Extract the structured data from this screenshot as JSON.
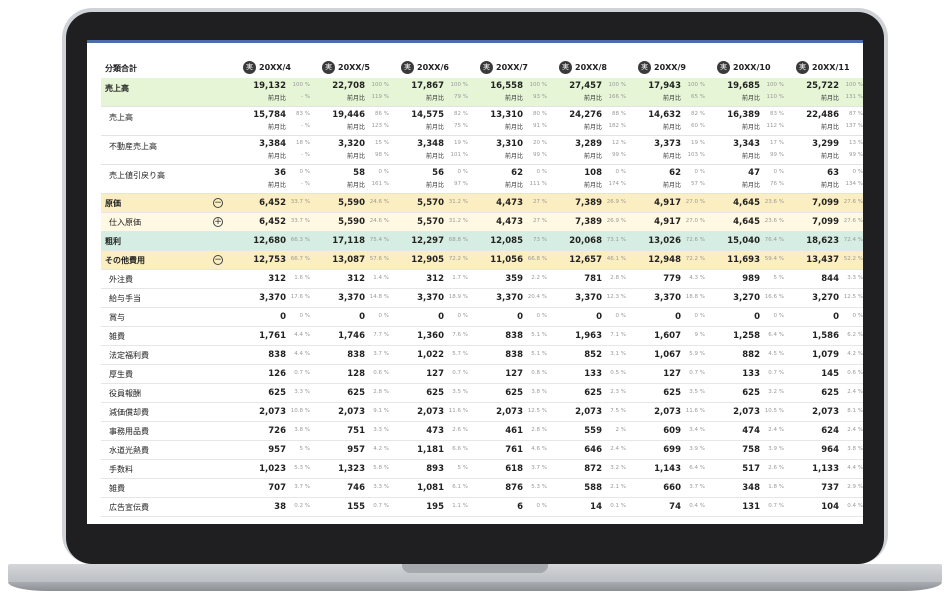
{
  "header": {
    "label": "分類合計",
    "icon_glyph": "実",
    "periods": [
      "20XX/4",
      "20XX/5",
      "20XX/6",
      "20XX/7",
      "20XX/8",
      "20XX/9",
      "20XX/10",
      "20XX/11"
    ]
  },
  "toggle_glyphs": {
    "collapse": "−",
    "expand": "+"
  },
  "sub_label": "前月比",
  "rows": [
    {
      "label": "売上高",
      "style": "sales",
      "double": true,
      "values": [
        "19,132",
        "22,708",
        "17,867",
        "16,558",
        "27,457",
        "17,943",
        "19,685",
        "25,722"
      ],
      "pcts": [
        "100 %",
        "100 %",
        "100 %",
        "100 %",
        "100 %",
        "100 %",
        "100 %",
        "100 %"
      ],
      "sub_pcts": [
        "- %",
        "119 %",
        "79 %",
        "93 %",
        "166 %",
        "65 %",
        "110 %",
        "131 %"
      ]
    },
    {
      "label": "売上高",
      "style": "",
      "indent": true,
      "double": true,
      "values": [
        "15,784",
        "19,446",
        "14,575",
        "13,310",
        "24,276",
        "14,632",
        "16,389",
        "22,486"
      ],
      "pcts": [
        "83 %",
        "86 %",
        "82 %",
        "80 %",
        "88 %",
        "82 %",
        "83 %",
        "87 %"
      ],
      "sub_pcts": [
        "- %",
        "123 %",
        "75 %",
        "91 %",
        "182 %",
        "60 %",
        "112 %",
        "137 %"
      ]
    },
    {
      "label": "不動産売上高",
      "style": "",
      "indent": true,
      "double": true,
      "values": [
        "3,384",
        "3,320",
        "3,348",
        "3,310",
        "3,289",
        "3,373",
        "3,343",
        "3,299"
      ],
      "pcts": [
        "18 %",
        "15 %",
        "19 %",
        "20 %",
        "12 %",
        "19 %",
        "17 %",
        "13 %"
      ],
      "sub_pcts": [
        "- %",
        "98 %",
        "101 %",
        "99 %",
        "99 %",
        "103 %",
        "99 %",
        "99 %"
      ]
    },
    {
      "label": "売上値引戻り高",
      "style": "",
      "indent": true,
      "double": true,
      "values": [
        "36",
        "58",
        "56",
        "62",
        "108",
        "62",
        "47",
        "63"
      ],
      "pcts": [
        "0 %",
        "0 %",
        "0 %",
        "0 %",
        "0 %",
        "0 %",
        "0 %",
        "0 %"
      ],
      "sub_pcts": [
        "- %",
        "161 %",
        "97 %",
        "111 %",
        "174 %",
        "57 %",
        "76 %",
        "134 %"
      ]
    },
    {
      "label": "原価",
      "style": "cost",
      "toggle": "collapse",
      "values": [
        "6,452",
        "5,590",
        "5,570",
        "4,473",
        "7,389",
        "4,917",
        "4,645",
        "7,099"
      ],
      "pcts": [
        "33.7 %",
        "24.6 %",
        "31.2 %",
        "27 %",
        "26.9 %",
        "27.0 %",
        "23.6 %",
        "27.6 %"
      ]
    },
    {
      "label": "仕入原価",
      "style": "cost-sub",
      "indent": true,
      "toggle": "expand",
      "values": [
        "6,452",
        "5,590",
        "5,570",
        "4,473",
        "7,389",
        "4,917",
        "4,645",
        "7,099"
      ],
      "pcts": [
        "33.7 %",
        "24.6 %",
        "31.2 %",
        "27 %",
        "26.9 %",
        "27.0 %",
        "23.6 %",
        "27.6 %"
      ]
    },
    {
      "label": "粗利",
      "style": "gross",
      "values": [
        "12,680",
        "17,118",
        "12,297",
        "12,085",
        "20,068",
        "13,026",
        "15,040",
        "18,623"
      ],
      "pcts": [
        "66.3 %",
        "75.4 %",
        "68.8 %",
        "73 %",
        "73.1 %",
        "72.6 %",
        "76.4 %",
        "72.4 %"
      ]
    },
    {
      "label": "その他費用",
      "style": "other",
      "toggle": "collapse",
      "values": [
        "12,753",
        "13,087",
        "12,905",
        "11,056",
        "12,657",
        "12,948",
        "11,693",
        "13,437"
      ],
      "pcts": [
        "66.7 %",
        "57.6 %",
        "72.2 %",
        "66.8 %",
        "46.1 %",
        "72.2 %",
        "59.4 %",
        "52.2 %"
      ]
    },
    {
      "label": "外注費",
      "indent": true,
      "values": [
        "312",
        "312",
        "312",
        "359",
        "781",
        "779",
        "989",
        "844"
      ],
      "pcts": [
        "1.6 %",
        "1.4 %",
        "1.7 %",
        "2.2 %",
        "2.8 %",
        "4.3 %",
        "5 %",
        "3.3 %"
      ]
    },
    {
      "label": "給与手当",
      "indent": true,
      "values": [
        "3,370",
        "3,370",
        "3,370",
        "3,370",
        "3,370",
        "3,370",
        "3,270",
        "3,270"
      ],
      "pcts": [
        "17.6 %",
        "14.8 %",
        "18.9 %",
        "20.4 %",
        "12.3 %",
        "18.8 %",
        "16.6 %",
        "12.5 %"
      ]
    },
    {
      "label": "賞与",
      "indent": true,
      "values": [
        "0",
        "0",
        "0",
        "0",
        "0",
        "0",
        "0",
        "0"
      ],
      "pcts": [
        "0 %",
        "0 %",
        "0 %",
        "0 %",
        "0 %",
        "0 %",
        "0 %",
        "0 %"
      ]
    },
    {
      "label": "雑費",
      "indent": true,
      "values": [
        "1,761",
        "1,746",
        "1,360",
        "838",
        "1,963",
        "1,607",
        "1,258",
        "1,586"
      ],
      "pcts": [
        "4.4 %",
        "7.7 %",
        "7.6 %",
        "5.1 %",
        "7.1 %",
        "9 %",
        "6.4 %",
        "6.2 %"
      ]
    },
    {
      "label": "法定福利費",
      "indent": true,
      "values": [
        "838",
        "838",
        "1,022",
        "838",
        "852",
        "1,067",
        "882",
        "1,079"
      ],
      "pcts": [
        "4.4 %",
        "3.7 %",
        "5.7 %",
        "5.1 %",
        "3.1 %",
        "5.9 %",
        "4.5 %",
        "4.2 %"
      ]
    },
    {
      "label": "厚生費",
      "indent": true,
      "values": [
        "126",
        "128",
        "127",
        "127",
        "133",
        "127",
        "133",
        "145"
      ],
      "pcts": [
        "0.7 %",
        "0.6 %",
        "0.7 %",
        "0.8 %",
        "0.5 %",
        "0.7 %",
        "0.7 %",
        "0.6 %"
      ]
    },
    {
      "label": "役員報酬",
      "indent": true,
      "values": [
        "625",
        "625",
        "625",
        "625",
        "625",
        "625",
        "625",
        "625"
      ],
      "pcts": [
        "3.3 %",
        "2.8 %",
        "3.5 %",
        "3.8 %",
        "2.3 %",
        "3.5 %",
        "3.2 %",
        "2.4 %"
      ]
    },
    {
      "label": "減価償却費",
      "indent": true,
      "values": [
        "2,073",
        "2,073",
        "2,073",
        "2,073",
        "2,073",
        "2,073",
        "2,073",
        "2,073"
      ],
      "pcts": [
        "10.8 %",
        "9.1 %",
        "11.6 %",
        "12.5 %",
        "7.5 %",
        "11.6 %",
        "10.5 %",
        "8.1 %"
      ]
    },
    {
      "label": "事務用品費",
      "indent": true,
      "values": [
        "726",
        "751",
        "473",
        "461",
        "559",
        "609",
        "474",
        "624"
      ],
      "pcts": [
        "3.8 %",
        "3.3 %",
        "2.6 %",
        "2.8 %",
        "2 %",
        "3.4 %",
        "2.4 %",
        "2.4 %"
      ]
    },
    {
      "label": "水道光熱費",
      "indent": true,
      "values": [
        "957",
        "957",
        "1,181",
        "761",
        "646",
        "699",
        "758",
        "964"
      ],
      "pcts": [
        "5 %",
        "4.2 %",
        "6.6 %",
        "4.6 %",
        "2.4 %",
        "3.9 %",
        "3.9 %",
        "3.8 %"
      ]
    },
    {
      "label": "手数料",
      "indent": true,
      "values": [
        "1,023",
        "1,323",
        "893",
        "618",
        "872",
        "1,143",
        "517",
        "1,133"
      ],
      "pcts": [
        "5.3 %",
        "5.8 %",
        "5 %",
        "3.7 %",
        "3.2 %",
        "6.4 %",
        "2.6 %",
        "4.4 %"
      ]
    },
    {
      "label": "雑費",
      "indent": true,
      "values": [
        "707",
        "746",
        "1,081",
        "876",
        "588",
        "660",
        "348",
        "737"
      ],
      "pcts": [
        "3.7 %",
        "3.3 %",
        "6.1 %",
        "5.3 %",
        "2.1 %",
        "3.7 %",
        "1.8 %",
        "2.9 %"
      ]
    },
    {
      "label": "広告宣伝費",
      "indent": true,
      "values": [
        "38",
        "155",
        "195",
        "6",
        "14",
        "74",
        "131",
        "104"
      ],
      "pcts": [
        "0.2 %",
        "0.7 %",
        "1.1 %",
        "0 %",
        "0.1 %",
        "0.4 %",
        "0.7 %",
        "0.4 %"
      ]
    }
  ]
}
